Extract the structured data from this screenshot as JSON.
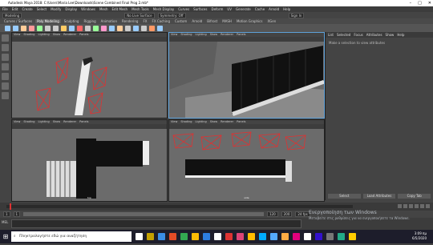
{
  "window": {
    "title": "Autodesk Maya 2018: C:\\Users\\Maria Lee\\Downloads\\Scene Combined Final Prog 2.mb*",
    "min_glyph": "–",
    "max_glyph": "□",
    "close_glyph": "✕"
  },
  "menubar": {
    "items": [
      "File",
      "Edit",
      "Create",
      "Select",
      "Modify",
      "Display",
      "Windows",
      "Mesh",
      "Edit Mesh",
      "Mesh Tools",
      "Mesh Display",
      "Curves",
      "Surfaces",
      "Deform",
      "UV",
      "Generate",
      "Cache",
      "Arnold",
      "Help"
    ]
  },
  "statusline": {
    "mode": "Modeling",
    "search_placeholder": "No Live Surface",
    "symmetry": "Symmetry: Off",
    "signin": "Sign In"
  },
  "shelf": {
    "tabs": [
      "Curves / Surfaces",
      "Poly Modeling",
      "Sculpting",
      "Rigging",
      "Animation",
      "Rendering",
      "FX",
      "FX Caching",
      "Custom",
      "Arnold",
      "Bifrost",
      "MASH",
      "Motion Graphics",
      "XGen"
    ],
    "active": 1,
    "icon_colors": [
      "#9cf",
      "#9cf",
      "#fc9",
      "#f99",
      "#9f9",
      "#ccc",
      "#ccc",
      "#fc6",
      "#9cf",
      "#f66",
      "#ccc",
      "#9f9",
      "#f9c",
      "#9cf",
      "#fc9",
      "#ccc",
      "#9cf",
      "#ccc",
      "#f96",
      "#9cf"
    ]
  },
  "viewports": {
    "menu": [
      "View",
      "Shading",
      "Lighting",
      "Show",
      "Renderer",
      "Panels"
    ],
    "top_label": "top",
    "side_label": "side",
    "accent": "#5ea1d9"
  },
  "side_panel": {
    "tabs": [
      "List",
      "Selected",
      "Focus",
      "Attributes",
      "Show",
      "Help"
    ],
    "message": "Make a selection to view attributes",
    "buttons": [
      "Select",
      "Load Attributes",
      "Copy Tab"
    ]
  },
  "time": {
    "start": "1",
    "end": "120",
    "ticks": [
      "1",
      "5",
      "10",
      "15",
      "20",
      "25",
      "30",
      "35",
      "40",
      "45",
      "50",
      "55",
      "60",
      "65",
      "70",
      "75",
      "80",
      "85",
      "90",
      "95",
      "100",
      "105",
      "110",
      "115",
      "120"
    ],
    "range_start": "1",
    "range_min": "1",
    "range_max": "120",
    "range_end": "200",
    "fps": "24 fps"
  },
  "command": {
    "label": "MEL"
  },
  "activation": {
    "title": "Ενεργοποίηση των Windows",
    "subtitle": "Μεταβείτε στις ρυθμίσεις για να ενεργοποιήσετε τα Windows."
  },
  "taskbar": {
    "search_placeholder": "Πληκτρολογήστε εδώ για αναζήτηση",
    "time": "3:09 πμ",
    "date": "6/5/2020",
    "icon_colors": [
      "#fff",
      "#c4a000",
      "#3a8ee6",
      "#e34c26",
      "#33a852",
      "#fbbc05",
      "#2d7de0",
      "#fff",
      "#d33",
      "#d47",
      "#fb0",
      "#0af",
      "#5af",
      "#fa4",
      "#e3007e",
      "#fff",
      "#31c",
      "#777",
      "#2a8",
      "#fc0"
    ]
  }
}
